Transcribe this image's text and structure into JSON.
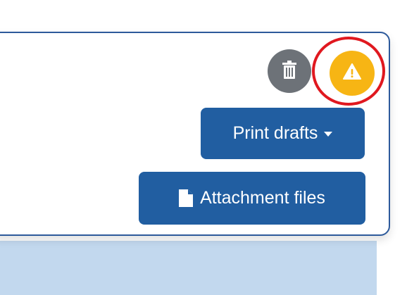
{
  "icons": {
    "trash": "trash-icon",
    "warning": "warning-icon",
    "file": "file-icon",
    "caret": "caret-down-icon"
  },
  "buttons": {
    "print_drafts_label": "Print drafts",
    "attachment_files_label": "Attachment files"
  },
  "colors": {
    "primary": "#215ea1",
    "card_border": "#2d5a9b",
    "trash_bg": "#6d7278",
    "warning_bg": "#f7b514",
    "highlight_ring": "#e0181f",
    "lower_panel": "#c2d8ee"
  }
}
